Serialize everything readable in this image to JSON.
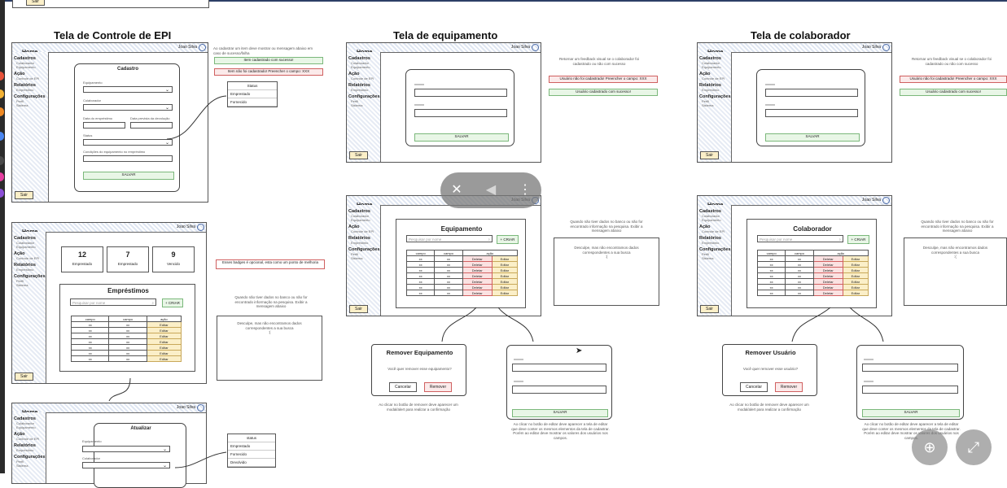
{
  "common": {
    "home": "Home",
    "user": "Joao Silva",
    "sair": "Sair",
    "cancelar": "Cancelar",
    "remover": "Remover",
    "deletar": "Deletar",
    "editar": "Editar",
    "criar": "+ CRIAR",
    "search_ph": "Pesquisar por nome",
    "cell": "xx"
  },
  "sidebar": {
    "cadastros": "Cadastros",
    "colaborador": "Colaborador",
    "equipamento": "Equipamento",
    "acao": "Ação",
    "controle_epi": "Controle de EPI",
    "relatorios": "Relatórios",
    "emprestimo": "Empréstimo",
    "configuracoes": "Configurações",
    "perfil": "Perfil",
    "sistema": "Sistema"
  },
  "epi": {
    "title": "Tela de Controle de EPI",
    "cadastro": "Cadastro",
    "equipamento": "Equipamento",
    "colaborador": "Colaborador",
    "data_emprestimo": "Data do empréstimo",
    "data_devolucao": "Data prevista da devolução",
    "status": "Status",
    "condicoes": "Condições do equipamento no empréstimo",
    "salvar": "SALVAR",
    "note": "Ao cadastrar um item deve mostrar ou mensagem abaixo em caso de sucesso/falha",
    "ok": "Item cadastrado com sucesso!",
    "err": "Item não foi cadastrado! Preencher o campo: XXX",
    "status_head": "Status",
    "status_opts": [
      "Emprestado",
      "Fornecido"
    ],
    "badges": [
      {
        "n": "12",
        "l": "Emprestado"
      },
      {
        "n": "7",
        "l": "Emprestado"
      },
      {
        "n": "9",
        "l": "Vencido"
      }
    ],
    "badge_note": "Esses badges é opcional, esta como um ponto de melhoria",
    "emprestimos": "Empréstimos",
    "cols": [
      "campo",
      "campo",
      "ação"
    ],
    "empty_note": "Quando não tiver dados no banco ou não for encontrado informação na pesquisa. Exibir a mensagem abaixo",
    "empty_msg": "Desculpe, mas não encontramos dados correspondentes a sua busca",
    "empty_sub": ":(",
    "atualizar": "Atualizar",
    "status2_head": "status",
    "status2_opts": [
      "Emprestado",
      "Fornecido",
      "Devolvido"
    ]
  },
  "equip": {
    "title": "Tela de equipamento",
    "field": "xxxxxx",
    "salvar": "SALVAR",
    "note": "Retornar um feedback visual se o colaborador foi cadastrado ou não com sucesso",
    "err": "Usuário não foi cadastrado! Preencher o campo: XXX",
    "ok": "Usuário cadastrado com sucesso!",
    "list_title": "Equipamento",
    "cols": [
      "campo",
      "campo",
      "ação"
    ],
    "empty_note": "Quando não tiver dados no banco ou não for encontrado informação na pesquisa. Exibir a mensagem abaixo",
    "empty_msg": "Desculpe, mas não encontramos dados correspondentes a sua busca",
    "empty_sub": ":(",
    "remove_title": "Remover Equipamento",
    "remove_q": "Você quer remover esse equipamento?",
    "remove_note": "Ao clicar no botão de remover deve aparecer um modal/alert para realizar a confirmação",
    "edit_note": "Ao clicar no botão de editar deve aparecer a tela de editar que deve conter os mesmos elementos da tela de cadastrar. Porém ao editar deve mostrar os valores dos usuários nos campos."
  },
  "colab": {
    "title": "Tela de colaborador",
    "field": "xxxxxx",
    "salvar": "SALVAR",
    "note": "Retornar um feedback visual se o colaborador foi cadastrado ou não com sucesso",
    "err": "Usuário não foi cadastrado! Preencher o campo: XXX",
    "ok": "Usuário cadastrado com sucesso!",
    "list_title": "Colaborador",
    "cols": [
      "campo",
      "campo",
      "ação"
    ],
    "empty_note": "Quando não tiver dados no banco ou não for encontrado informação na pesquisa. Exibir a mensagem abaixo",
    "empty_msg": "Desculpe, mas não encontramos dados correspondentes a sua busca",
    "empty_sub": ":(",
    "remove_title": "Remover Usuário",
    "remove_q": "Você quer remover esse usuário?",
    "remove_note": "Ao clicar no botão de remover deve aparecer um modal/alert para realizar a confirmação",
    "edit_note": "Ao clicar no botão de editar deve aparecer a tela de editar que deve conter os mesmos elementos da tela de cadastrar. Porém ao editar deve mostrar os valores dos usuários nos campos."
  },
  "viewer": {
    "icons": [
      "pin-off-icon",
      "mute-icon",
      "more-vert-icon",
      "zoom-in-icon",
      "expand-icon"
    ]
  }
}
